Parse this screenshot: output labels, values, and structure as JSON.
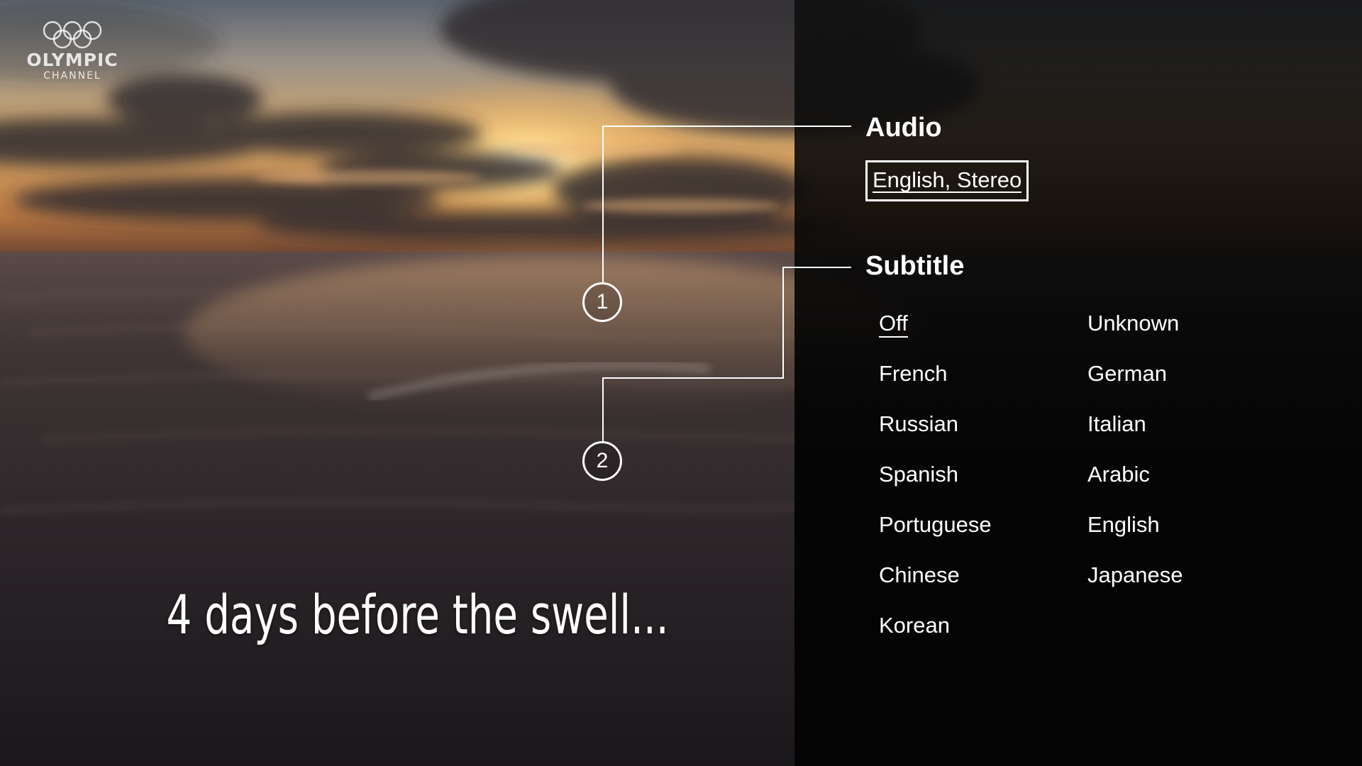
{
  "logo": {
    "word": "OLYMPIC",
    "sub": "CHANNEL"
  },
  "caption": "4 days before the swell...",
  "audio": {
    "title": "Audio",
    "selected": "English, Stereo"
  },
  "subtitle": {
    "title": "Subtitle",
    "selected": "Off",
    "options": [
      "Off",
      "Unknown",
      "French",
      "German",
      "Russian",
      "Italian",
      "Spanish",
      "Arabic",
      "Portuguese",
      "English",
      "Chinese",
      "Japanese",
      "Korean"
    ]
  },
  "callouts": [
    "1",
    "2"
  ],
  "colors": {
    "panel": "#050505",
    "text": "#ffffff",
    "sky": "#e9c48a",
    "sea": "#2a2428"
  }
}
